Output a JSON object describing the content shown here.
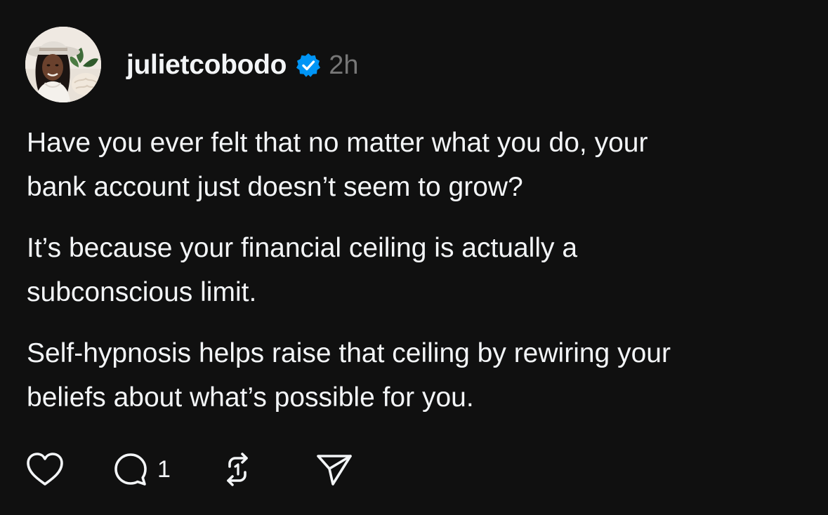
{
  "post": {
    "username": "julietcobodo",
    "timestamp": "2h",
    "verified": true,
    "avatar_icon": "profile-photo-avatar",
    "paragraphs": [
      "Have you ever felt that no matter what you do, your\nbank account just doesn’t seem to grow?",
      "It’s because your financial ceiling is actually a\nsubconscious limit.",
      "Self-hypnosis helps raise that ceiling by rewiring your\nbeliefs about what’s possible for you."
    ],
    "actions": {
      "like_icon": "heart-icon",
      "reply_icon": "comment-icon",
      "reply_count": "1",
      "repost_icon": "repost-icon",
      "share_icon": "send-icon"
    }
  },
  "colors": {
    "background": "#101010",
    "text": "#f3f5f7",
    "muted": "#777777",
    "verified_badge": "#0095f6"
  }
}
